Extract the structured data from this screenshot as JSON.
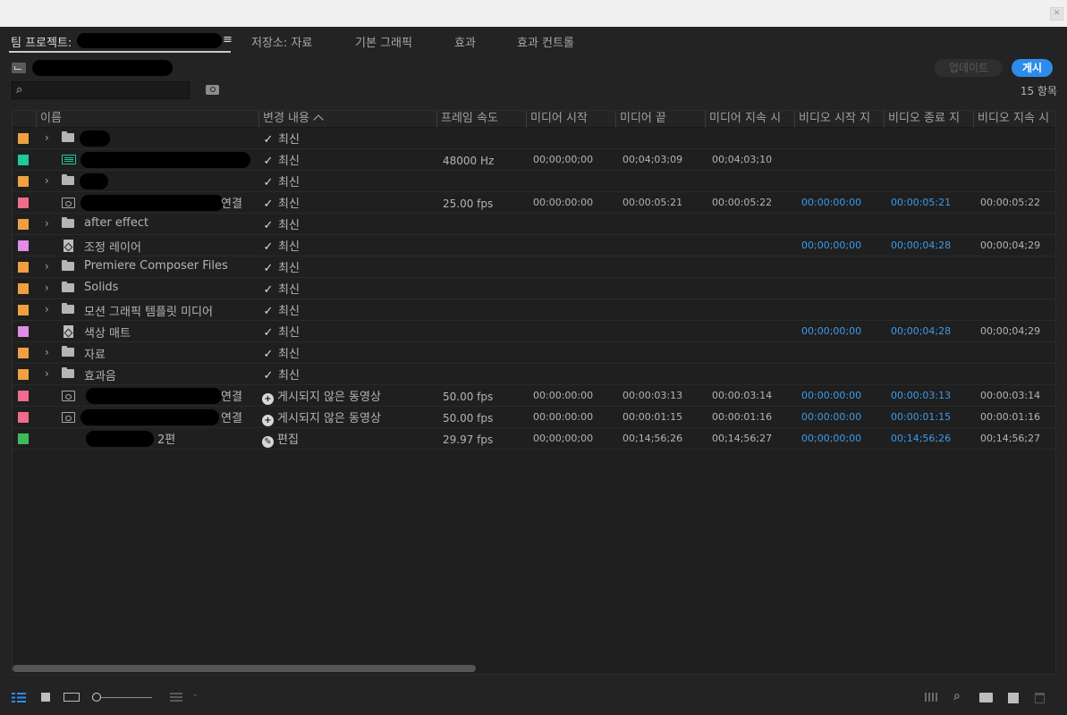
{
  "panel_tabs": [
    {
      "label": "팀 프로젝트:"
    },
    {
      "label": "≡"
    },
    {
      "label": "저장소: 자료"
    },
    {
      "label": "기본 그래픽"
    },
    {
      "label": "효과"
    },
    {
      "label": "효과 컨트롤"
    }
  ],
  "toolbar": {
    "search_placeholder": "",
    "update_label": "업데이트",
    "publish_label": "게시",
    "item_count": "15 항목"
  },
  "columns": [
    "이름",
    "변경 내용",
    "프레임 속도",
    "미디어 시작",
    "미디어 끝",
    "미디어 지속 시",
    "비디오 시작 지",
    "비디오 종료 지",
    "비디오 지속 시"
  ],
  "icons": {
    "search": "search-icon",
    "check": "✓",
    "chevron": "›"
  },
  "colors": {
    "orange": "#f0a040",
    "teal": "#1ec8a0",
    "pink": "#f06b8c",
    "violet": "#e08ce8",
    "green": "#3cbc5c",
    "accent": "#2d8ceb",
    "blue_text": "#3e9ae8"
  },
  "rows": [
    {
      "label_color": "#f0a040",
      "chevron": "›",
      "icon": "folder",
      "name": "",
      "suffix": "",
      "status_type": "check",
      "status": "최신",
      "fps": "",
      "ms": "",
      "me": "",
      "md": "",
      "vs": "",
      "ve": "",
      "vd": ""
    },
    {
      "label_color": "#1ec8a0",
      "chevron": "",
      "icon": "audio",
      "name": "",
      "suffix": "",
      "status_type": "check",
      "status": "최신",
      "fps": "48000 Hz",
      "ms": "00;00;00;00",
      "me": "00;04;03;09",
      "md": "00;04;03;10",
      "vs": "",
      "ve": "",
      "vd": ""
    },
    {
      "label_color": "#f0a040",
      "chevron": "›",
      "icon": "folder",
      "name": "",
      "suffix": "",
      "status_type": "check",
      "status": "최신",
      "fps": "",
      "ms": "",
      "me": "",
      "md": "",
      "vs": "",
      "ve": "",
      "vd": ""
    },
    {
      "label_color": "#f06b8c",
      "chevron": "",
      "icon": "clip",
      "name": "",
      "suffix": "연결",
      "status_type": "check",
      "status": "최신",
      "fps": "25.00 fps",
      "ms": "00:00:00:00",
      "me": "00:00:05:21",
      "md": "00:00:05:22",
      "vs": "00:00:00:00",
      "ve": "00:00:05:21",
      "vd": "00:00:05:22"
    },
    {
      "label_color": "#f0a040",
      "chevron": "›",
      "icon": "folder",
      "name": "after effect",
      "suffix": "",
      "status_type": "check",
      "status": "최신",
      "fps": "",
      "ms": "",
      "me": "",
      "md": "",
      "vs": "",
      "ve": "",
      "vd": ""
    },
    {
      "label_color": "#e08ce8",
      "chevron": "",
      "icon": "doc",
      "name": "조정 레이어",
      "suffix": "",
      "status_type": "check",
      "status": "최신",
      "fps": "",
      "ms": "",
      "me": "",
      "md": "",
      "vs": "00;00;00;00",
      "ve": "00;00;04;28",
      "vd": "00;00;04;29"
    },
    {
      "label_color": "#f0a040",
      "chevron": "›",
      "icon": "folder",
      "name": "Premiere Composer Files",
      "suffix": "",
      "status_type": "check",
      "status": "최신",
      "fps": "",
      "ms": "",
      "me": "",
      "md": "",
      "vs": "",
      "ve": "",
      "vd": ""
    },
    {
      "label_color": "#f0a040",
      "chevron": "›",
      "icon": "folder",
      "name": "Solids",
      "suffix": "",
      "status_type": "check",
      "status": "최신",
      "fps": "",
      "ms": "",
      "me": "",
      "md": "",
      "vs": "",
      "ve": "",
      "vd": ""
    },
    {
      "label_color": "#f0a040",
      "chevron": "›",
      "icon": "folder",
      "name": "모션 그래픽 템플릿 미디어",
      "suffix": "",
      "status_type": "check",
      "status": "최신",
      "fps": "",
      "ms": "",
      "me": "",
      "md": "",
      "vs": "",
      "ve": "",
      "vd": ""
    },
    {
      "label_color": "#e08ce8",
      "chevron": "",
      "icon": "doc",
      "name": "색상 매트",
      "suffix": "",
      "status_type": "check",
      "status": "최신",
      "fps": "",
      "ms": "",
      "me": "",
      "md": "",
      "vs": "00;00;00;00",
      "ve": "00;00;04;28",
      "vd": "00;00;04;29"
    },
    {
      "label_color": "#f0a040",
      "chevron": "›",
      "icon": "folder",
      "name": "자료",
      "suffix": "",
      "status_type": "check",
      "status": "최신",
      "fps": "",
      "ms": "",
      "me": "",
      "md": "",
      "vs": "",
      "ve": "",
      "vd": ""
    },
    {
      "label_color": "#f0a040",
      "chevron": "›",
      "icon": "folder",
      "name": "효과음",
      "suffix": "",
      "status_type": "check",
      "status": "최신",
      "fps": "",
      "ms": "",
      "me": "",
      "md": "",
      "vs": "",
      "ve": "",
      "vd": ""
    },
    {
      "label_color": "#f06b8c",
      "chevron": "",
      "icon": "clip",
      "name": "",
      "suffix": "연결",
      "status_type": "plus",
      "status": "게시되지 않은 동영상",
      "fps": "50.00 fps",
      "ms": "00:00:00:00",
      "me": "00:00:03:13",
      "md": "00:00:03:14",
      "vs": "00:00:00:00",
      "ve": "00:00:03:13",
      "vd": "00:00:03:14"
    },
    {
      "label_color": "#f06b8c",
      "chevron": "",
      "icon": "clip",
      "name": "",
      "suffix": "연결",
      "status_type": "plus",
      "status": "게시되지 않은 동영상",
      "fps": "50.00 fps",
      "ms": "00:00:00:00",
      "me": "00:00:01:15",
      "md": "00:00:01:16",
      "vs": "00:00:00:00",
      "ve": "00:00:01:15",
      "vd": "00:00:01:16"
    },
    {
      "label_color": "#3cbc5c",
      "chevron": "",
      "icon": "sequence",
      "name": "",
      "suffix": "2편",
      "status_type": "pencil",
      "status": "편집",
      "fps": "29.97 fps",
      "ms": "00;00;00;00",
      "me": "00;14;56;26",
      "md": "00;14;56;27",
      "vs": "00;00;00;00",
      "ve": "00;14;56;26",
      "vd": "00;14;56;27"
    }
  ]
}
